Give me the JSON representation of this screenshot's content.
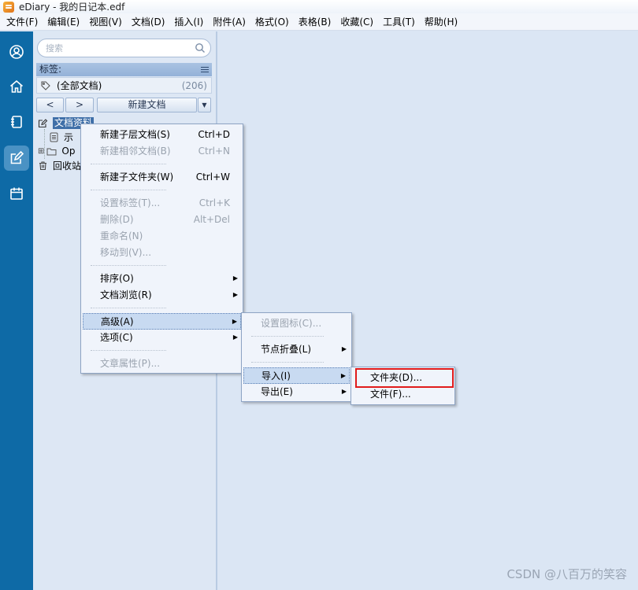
{
  "window": {
    "title": "eDiary - 我的日记本.edf"
  },
  "menubar": [
    "文件(F)",
    "编辑(E)",
    "视图(V)",
    "文档(D)",
    "插入(I)",
    "附件(A)",
    "格式(O)",
    "表格(B)",
    "收藏(C)",
    "工具(T)",
    "帮助(H)"
  ],
  "leftnav": [
    "user-icon",
    "home-icon",
    "notebook-icon",
    "edit-icon",
    "calendar-icon"
  ],
  "sidebar": {
    "search_placeholder": "搜索",
    "tags_label": "标签:",
    "all_docs_label": "(全部文档)",
    "all_docs_count": "(206)",
    "prev_btn": "<",
    "next_btn": ">",
    "new_doc_btn": "新建文档",
    "tree": {
      "root": "文档资料",
      "child1": "示",
      "child2": "Op",
      "recycle": "回收站"
    }
  },
  "context_main": {
    "new_child_doc": "新建子层文档(S)",
    "new_child_doc_sc": "Ctrl+D",
    "new_sibling_doc": "新建相邻文档(B)",
    "new_sibling_doc_sc": "Ctrl+N",
    "new_child_folder": "新建子文件夹(W)",
    "new_child_folder_sc": "Ctrl+W",
    "set_tags": "设置标签(T)...",
    "set_tags_sc": "Ctrl+K",
    "delete": "删除(D)",
    "delete_sc": "Alt+Del",
    "rename": "重命名(N)",
    "move_to": "移动到(V)...",
    "sort": "排序(O)",
    "doc_browse": "文档浏览(R)",
    "advanced": "高级(A)",
    "options": "选项(C)",
    "properties": "文章属性(P)..."
  },
  "context_advanced": {
    "set_icon": "设置图标(C)...",
    "node_fold": "节点折叠(L)",
    "import": "导入(I)",
    "export": "导出(E)"
  },
  "context_import": {
    "folder": "文件夹(D)...",
    "file": "文件(F)..."
  },
  "watermark": "CSDN @八百万的笑容"
}
